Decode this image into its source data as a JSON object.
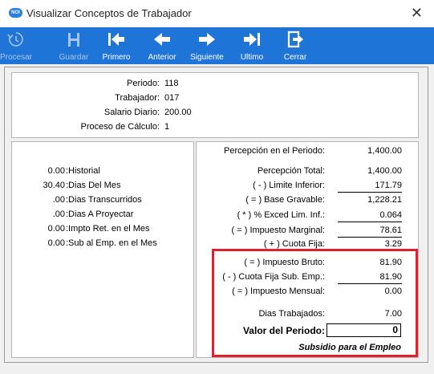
{
  "window": {
    "title": "Visualizar Conceptos de Trabajador",
    "icon": "nomina-logo-icon",
    "close_icon": "close-icon"
  },
  "toolbar": {
    "items": [
      {
        "label": "Procesar",
        "icon": "process-icon",
        "enabled": false
      },
      {
        "label": "Guardar",
        "icon": "save-icon",
        "enabled": false
      },
      {
        "label": "Primero",
        "icon": "first-record-icon",
        "enabled": true
      },
      {
        "label": "Anterior",
        "icon": "previous-arrow-icon",
        "enabled": true
      },
      {
        "label": "Siguiente",
        "icon": "next-arrow-icon",
        "enabled": true
      },
      {
        "label": "Ultimo",
        "icon": "last-record-icon",
        "enabled": true
      },
      {
        "label": "Cerrar",
        "icon": "close-door-icon",
        "enabled": true
      }
    ],
    "bar_color": "#1f74d8"
  },
  "header": {
    "periodo_label": "Periodo:",
    "periodo_value": "118",
    "trabajador_label": "Trabajador:",
    "trabajador_value": "017",
    "salario_label": "Salario Diario:",
    "salario_value": "200.00",
    "proceso_label": "Proceso de Cálculo:",
    "proceso_value": "1"
  },
  "left_panel": [
    {
      "value": "0.00",
      "label": ":Historial"
    },
    {
      "value": "30.40",
      "label": ":Dias Del Mes"
    },
    {
      "value": ".00",
      "label": ":Dias Transcurridos"
    },
    {
      "value": ".00",
      "label": ":Dias A Proyectar"
    },
    {
      "value": "0.00",
      "label": ":Impto Ret. en el Mes"
    },
    {
      "value": "0.00",
      "label": ":Sub al Emp. en el Mes"
    }
  ],
  "right_panel": {
    "percepcion_periodo_label": "Percepción en el Periodo:",
    "percepcion_periodo_value": "1,400.00",
    "percepcion_total_label": "Percepción Total:",
    "percepcion_total_value": "1,400.00",
    "limite_inferior_label": "( - ) Limite Inferior:",
    "limite_inferior_value": "171.79",
    "base_gravable_label": "( = ) Base Gravable:",
    "base_gravable_value": "1,228.21",
    "exced_label": "( * ) % Exced Lim. Inf.:",
    "exced_value": "0.064",
    "impuesto_marginal_label": "( = ) Impuesto Marginal:",
    "impuesto_marginal_value": "78.61",
    "cuota_fija_label": "( + ) Cuota Fija:",
    "cuota_fija_value": "3.29",
    "impuesto_bruto_label": "( = ) Impuesto Bruto:",
    "impuesto_bruto_value": "81.90",
    "cuota_fija_sub_label": "( - ) Cuota Fija Sub. Emp.:",
    "cuota_fija_sub_value": "81.90",
    "impuesto_mensual_label": "( = ) Impuesto Mensual:",
    "impuesto_mensual_value": "0.00",
    "dias_trabajados_label": "Dias Trabajados:",
    "dias_trabajados_value": "7.00",
    "valor_periodo_label": "Valor del Periodo:",
    "valor_periodo_value": "0",
    "subsidio_label": "Subsidio para el Empleo",
    "highlight_color": "#e0202b"
  }
}
